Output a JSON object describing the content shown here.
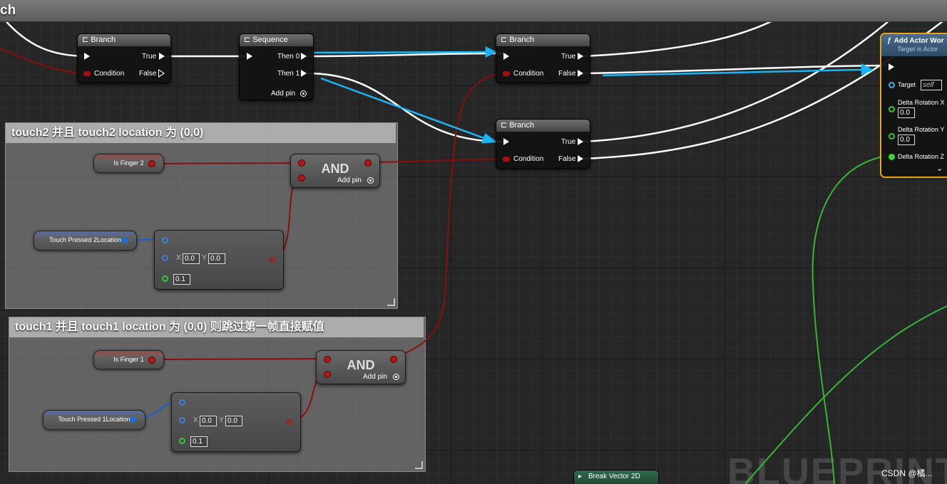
{
  "graph": {
    "title_fragment": "ch",
    "watermark": "BLUEPRINT",
    "credit": "CSDN @橘..."
  },
  "comments": [
    {
      "title": "touch2 并且 touch2 location 为 (0,0)"
    },
    {
      "title": "touch1 并且 touch1 location 为 (0,0) 则跳过第一帧直接赋值"
    }
  ],
  "nodes": {
    "branch1": {
      "title": "Branch",
      "true_label": "True",
      "false_label": "False",
      "condition_label": "Condition"
    },
    "sequence": {
      "title": "Sequence",
      "then0": "Then 0",
      "then1": "Then 1",
      "add_pin": "Add pin"
    },
    "branch2": {
      "title": "Branch",
      "true_label": "True",
      "false_label": "False",
      "condition_label": "Condition"
    },
    "branch3": {
      "title": "Branch",
      "true_label": "True",
      "false_label": "False",
      "condition_label": "Condition"
    },
    "add_actor": {
      "title": "Add Actor Wor",
      "subtitle": "Target is Actor",
      "target_label": "Target",
      "target_value": "self",
      "dx_label": "Delta Rotation X",
      "dx_value": "0.0",
      "dy_label": "Delta Rotation Y",
      "dy_value": "0.0",
      "dz_label": "Delta Rotation Z",
      "expand": "⌄"
    },
    "and2": {
      "title": "AND",
      "add_pin": "Add pin"
    },
    "and1": {
      "title": "AND",
      "add_pin": "Add pin"
    },
    "is_finger2": {
      "label": "Is Finger 2"
    },
    "is_finger1": {
      "label": "Is Finger 1"
    },
    "touch2_loc": {
      "label": "Touch Pressed 2Location"
    },
    "touch1_loc": {
      "label": "Touch Pressed 1Location"
    },
    "compare2": {
      "x_label": "X",
      "x_value": "0.0",
      "y_label": "Y",
      "y_value": "0.0",
      "tol_value": "0.1"
    },
    "compare1": {
      "x_label": "X",
      "x_value": "0.0",
      "y_label": "Y",
      "y_value": "0.0",
      "tol_value": "0.1"
    },
    "break_vector": {
      "title": "Break Vector 2D"
    }
  },
  "colors": {
    "exec_wire": "#ffffff",
    "bool_wire": "#8a0e0e",
    "vector_wire": "#1a5fd0",
    "float_wire": "#36b436",
    "highlight_arrow": "#19b5f5",
    "call_function_border": "#e8a317"
  }
}
